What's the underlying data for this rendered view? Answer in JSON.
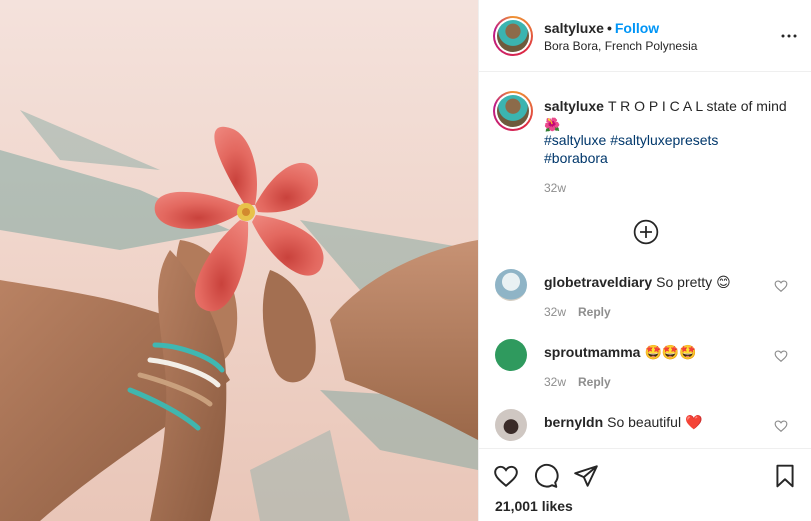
{
  "post": {
    "author": {
      "username": "saltyluxe",
      "follow_label": "Follow",
      "separator": "•",
      "location": "Bora Bora, French Polynesia"
    },
    "caption": {
      "username": "saltyluxe",
      "text": "T R O P I C A L state of mind",
      "emoji": "🌺",
      "hashtags": [
        "#saltyluxe",
        "#saltyluxepresets",
        "#borabora"
      ],
      "time": "32w"
    },
    "comments": [
      {
        "username": "globetraveldiary",
        "text": "So pretty 😊",
        "time": "32w",
        "reply_label": "Reply"
      },
      {
        "username": "sproutmamma",
        "text": "🤩🤩🤩",
        "time": "32w",
        "reply_label": "Reply"
      },
      {
        "username": "bernyldn",
        "text": "So beautiful ❤️"
      }
    ],
    "likes": "21,001 likes"
  },
  "icons": {
    "more": "more-options-icon",
    "load_more": "plus-circle-icon",
    "like": "heart-icon",
    "comment": "comment-icon",
    "share": "share-icon",
    "save": "bookmark-icon"
  },
  "colors": {
    "follow": "#0095f6",
    "hashtag": "#00376b",
    "muted": "#8e8e8e",
    "flower": "#e2615a"
  }
}
